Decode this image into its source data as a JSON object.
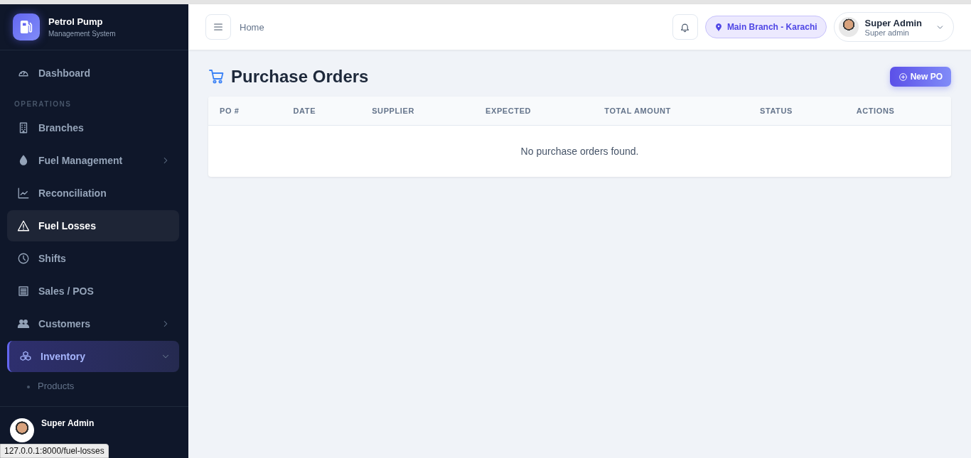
{
  "brand": {
    "title": "Petrol Pump",
    "subtitle": "Management System"
  },
  "sidebar": {
    "items": [
      {
        "label": "Dashboard",
        "selected": false,
        "hovered": false
      },
      {
        "kind": "section",
        "label": "OPERATIONS"
      },
      {
        "label": "Branches",
        "selected": false,
        "hovered": false
      },
      {
        "label": "Fuel Management",
        "selected": false,
        "hovered": false,
        "expanded": false
      },
      {
        "label": "Reconciliation",
        "selected": false,
        "hovered": false
      },
      {
        "label": "Fuel Losses",
        "selected": false,
        "hovered": true
      },
      {
        "label": "Shifts",
        "selected": false,
        "hovered": false
      },
      {
        "label": "Sales / POS",
        "selected": false,
        "hovered": false
      },
      {
        "label": "Customers",
        "selected": false,
        "hovered": false,
        "expanded": false
      },
      {
        "label": "Inventory",
        "selected": true,
        "hovered": false,
        "expanded": true,
        "children": [
          {
            "label": "Products",
            "selected": false
          }
        ]
      }
    ]
  },
  "sidebar_user": {
    "name": "Super Admin"
  },
  "status_url": "127.0.0.1:8000/fuel-losses",
  "topbar": {
    "breadcrumb": "Home",
    "branch": "Main Branch - Karachi",
    "user": {
      "name": "Super Admin",
      "role": "Super admin"
    }
  },
  "page": {
    "title": "Purchase Orders",
    "new_button": "New PO"
  },
  "table": {
    "columns": [
      "PO #",
      "DATE",
      "SUPPLIER",
      "EXPECTED",
      "TOTAL AMOUNT",
      "STATUS",
      "ACTIONS"
    ],
    "empty_message": "No purchase orders found."
  }
}
